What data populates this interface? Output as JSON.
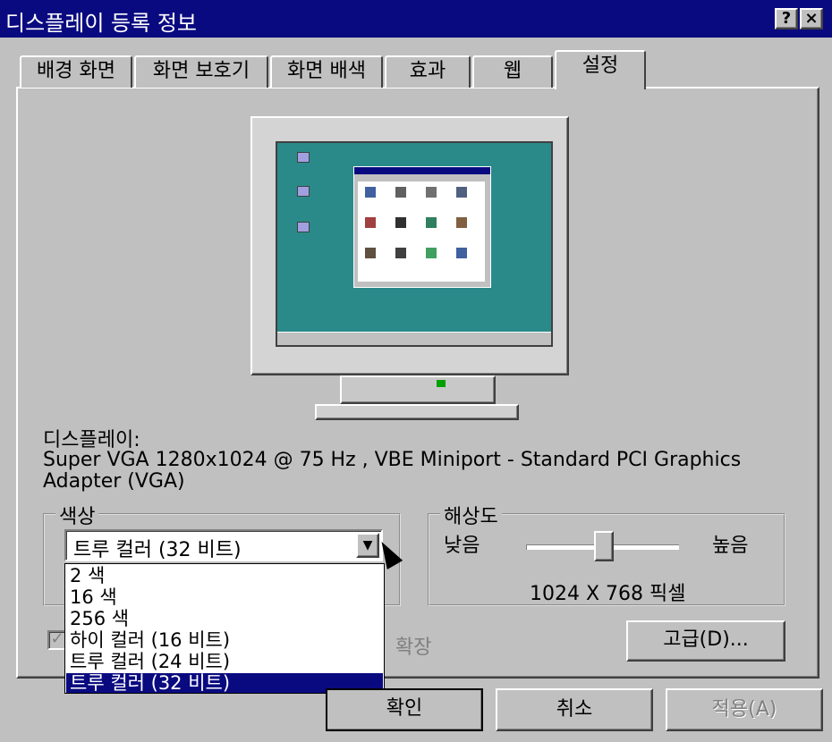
{
  "window": {
    "title": "디스플레이 등록 정보",
    "help_btn": "?",
    "close_btn": "×"
  },
  "tabs": [
    {
      "label": "배경 화면"
    },
    {
      "label": "화면 보호기"
    },
    {
      "label": "화면 배색"
    },
    {
      "label": "효과"
    },
    {
      "label": "웹"
    },
    {
      "label": "설정"
    }
  ],
  "display": {
    "heading": "디스플레이:",
    "line1": "Super VGA 1280x1024 @ 75 Hz , VBE Miniport - Standard PCI Graphics",
    "line2": "Adapter (VGA)"
  },
  "color": {
    "legend": "색상",
    "selected": "트루 컬러 (32 비트)",
    "options": [
      "2 색",
      "16 색",
      "256 색",
      "하이 컬러 (16 비트)",
      "트루 컬러 (24 비트)",
      "트루 컬러 (32 비트)"
    ],
    "highlighted_index": 5
  },
  "resolution": {
    "legend": "해상도",
    "low": "낮음",
    "high": "높음",
    "value": "1024 X 768 픽셀",
    "slider_fraction": 0.5
  },
  "extend": {
    "label": "확장",
    "checked": true
  },
  "buttons": {
    "advanced": "고급(D)...",
    "ok": "확인",
    "cancel": "취소",
    "apply": "적용(A)"
  },
  "colors": {
    "titlebar": "#0a0a80",
    "face": "#c0c0c0",
    "desktop": "#2a8a8a"
  }
}
